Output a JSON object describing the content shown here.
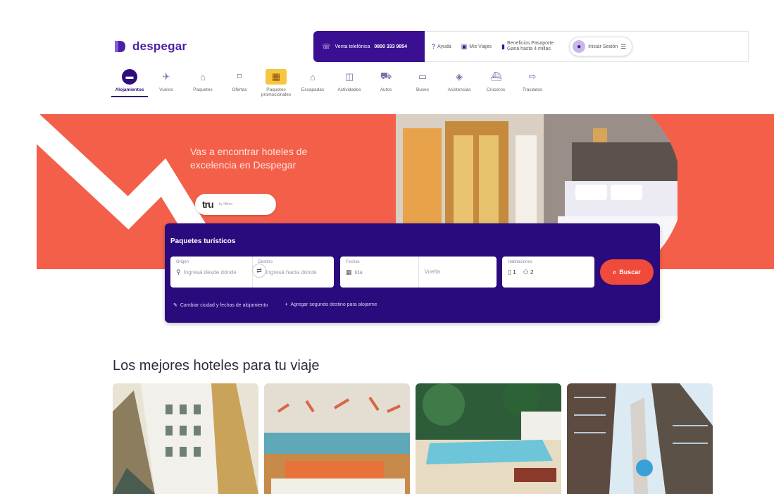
{
  "brand": {
    "logo_text": "despegar",
    "primary_color": "#3b0f91",
    "accent_color": "#f45f4a"
  },
  "header": {
    "phone_label": "Venta telefónica",
    "phone_number": "0800 333 9854",
    "links": [
      {
        "label": "Ayuda",
        "icon": "help-icon"
      },
      {
        "label": "Mis Viajes",
        "icon": "suitcase-icon"
      },
      {
        "label": "Beneficios Pasaporte",
        "sub": "Ganá hasta 4 millas",
        "icon": "passport-icon"
      }
    ],
    "account_label": "Iniciar Sesión"
  },
  "products": [
    {
      "label": "Alojamientos",
      "icon": "bed-icon",
      "active": true
    },
    {
      "label": "Vuelos",
      "icon": "plane-icon"
    },
    {
      "label": "Paquetes",
      "icon": "package-icon"
    },
    {
      "label": "Ofertas",
      "icon": "tag-icon"
    },
    {
      "label": "Paquetes promocionales",
      "icon": "gift-icon",
      "featured": true
    },
    {
      "label": "Escapadas",
      "icon": "home-icon"
    },
    {
      "label": "Actividades",
      "icon": "ticket-icon"
    },
    {
      "label": "Autos",
      "icon": "car-icon"
    },
    {
      "label": "Buses",
      "icon": "bus-icon"
    },
    {
      "label": "Asistencias",
      "icon": "shield-icon"
    },
    {
      "label": "Cruceros",
      "icon": "ship-icon"
    },
    {
      "label": "Traslados",
      "icon": "shuttle-icon"
    }
  ],
  "hero": {
    "title": "Vas a encontrar hoteles de excelencia en Despegar",
    "badge_logo": "tru",
    "badge_text": "by Hilton"
  },
  "search": {
    "title": "Paquetes turísticos",
    "origin": {
      "label": "Origen",
      "placeholder": "Ingresá desde dónde"
    },
    "destination": {
      "label": "Destino",
      "placeholder": "Ingresá hacia dónde"
    },
    "dates": {
      "label": "Fechas",
      "from": "Ida",
      "to": "Vuelta"
    },
    "guests": {
      "label": "Habitaciones",
      "rooms": "1",
      "people": "2"
    },
    "button_label": "Buscar",
    "options": [
      "Cambiar ciudad y fechas de alojamiento",
      "Agregar segundo destino para alojarme"
    ]
  },
  "section": {
    "title": "Los mejores hoteles para tu viaje"
  }
}
